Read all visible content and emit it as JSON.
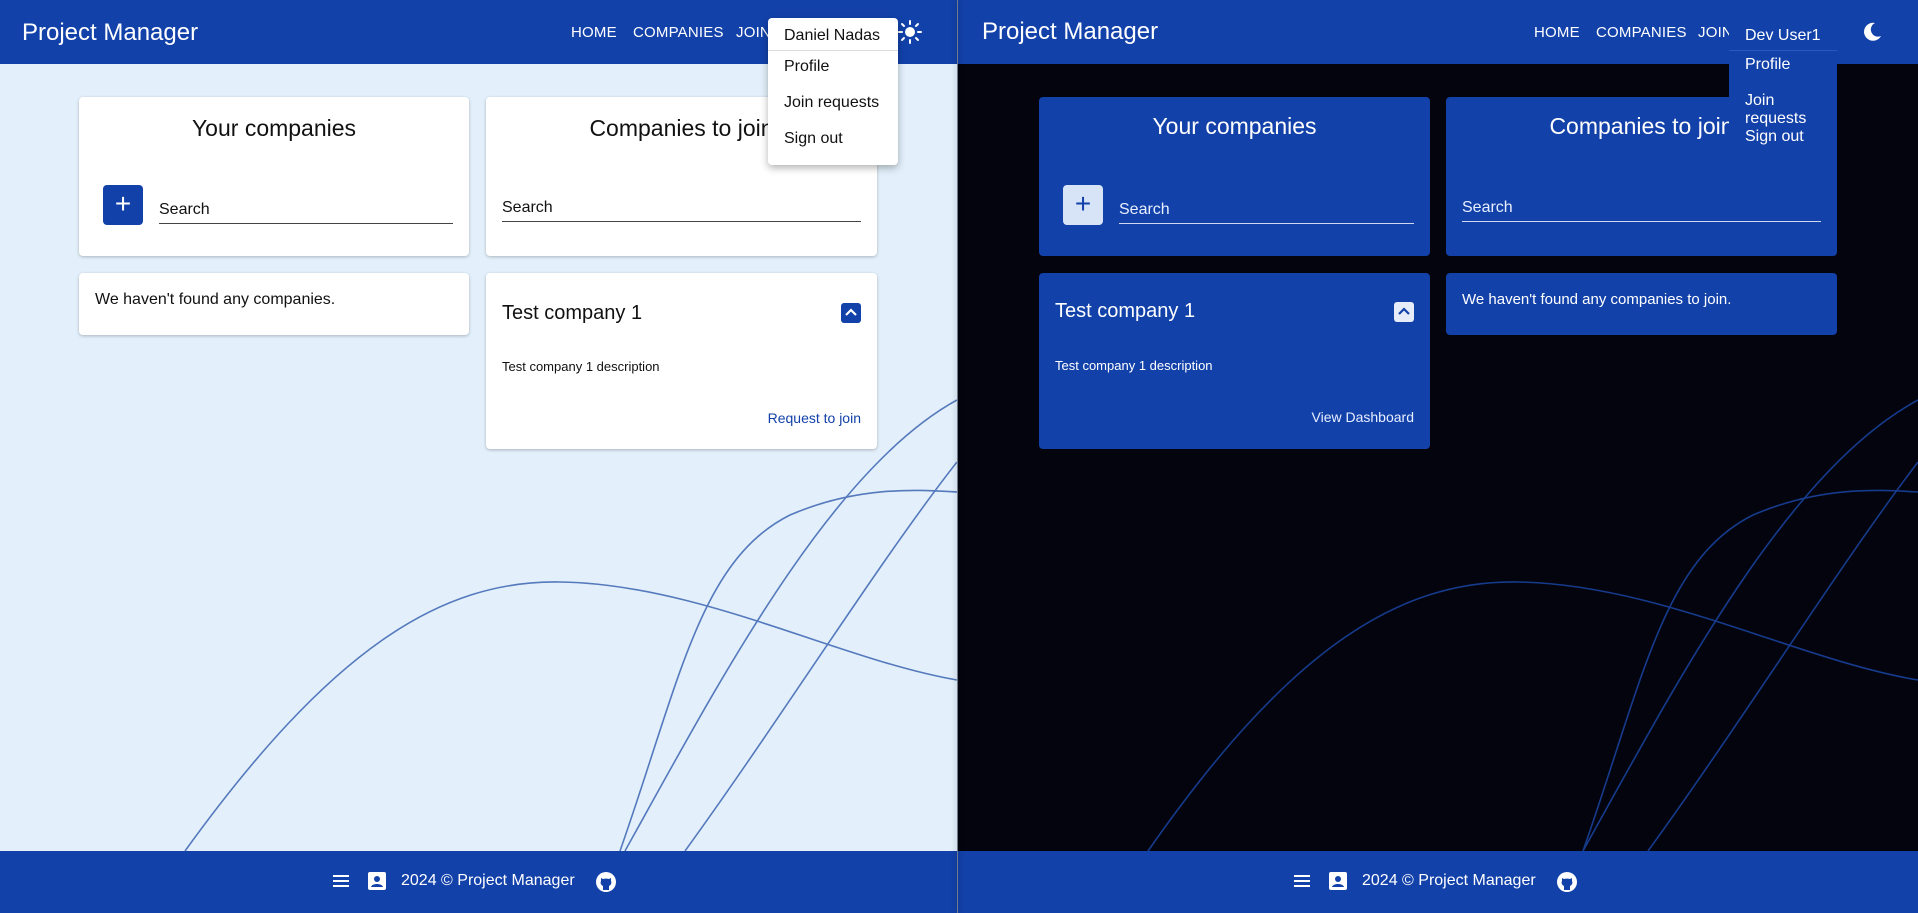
{
  "light": {
    "app_title": "Project Manager",
    "nav": {
      "home": "HOME",
      "companies": "COMPANIES",
      "join": "JOIN"
    },
    "theme_icon": "sun-icon",
    "menu": {
      "user": "Daniel Nadas",
      "profile": "Profile",
      "join_requests": "Join requests",
      "sign_out": "Sign out"
    },
    "your_companies": {
      "title": "Your companies",
      "add_label": "+",
      "search_placeholder": "Search",
      "empty_message": "We haven't found any companies."
    },
    "companies_to_join": {
      "title": "Companies to join",
      "search_placeholder": "Search",
      "company": {
        "name": "Test company 1",
        "description": "Test company 1 description",
        "action": "Request to join"
      }
    },
    "footer": {
      "text": "2024 © Project Manager"
    }
  },
  "dark": {
    "app_title": "Project Manager",
    "nav": {
      "home": "HOME",
      "companies": "COMPANIES",
      "join": "JOIN"
    },
    "theme_icon": "moon-icon",
    "menu": {
      "user": "Dev User1",
      "profile": "Profile",
      "join_requests": "Join requests",
      "sign_out": "Sign out"
    },
    "your_companies": {
      "title": "Your companies",
      "add_label": "+",
      "search_placeholder": "Search",
      "company": {
        "name": "Test company 1",
        "description": "Test company 1 description",
        "action": "View Dashboard"
      }
    },
    "companies_to_join": {
      "title": "Companies to join",
      "search_placeholder": "Search",
      "empty_message": "We haven't found any companies to join."
    },
    "footer": {
      "text": "2024 © Project Manager"
    }
  },
  "colors": {
    "primary": "#1241a9",
    "light_background": "#e3f0fb",
    "dark_background": "#03040e"
  }
}
